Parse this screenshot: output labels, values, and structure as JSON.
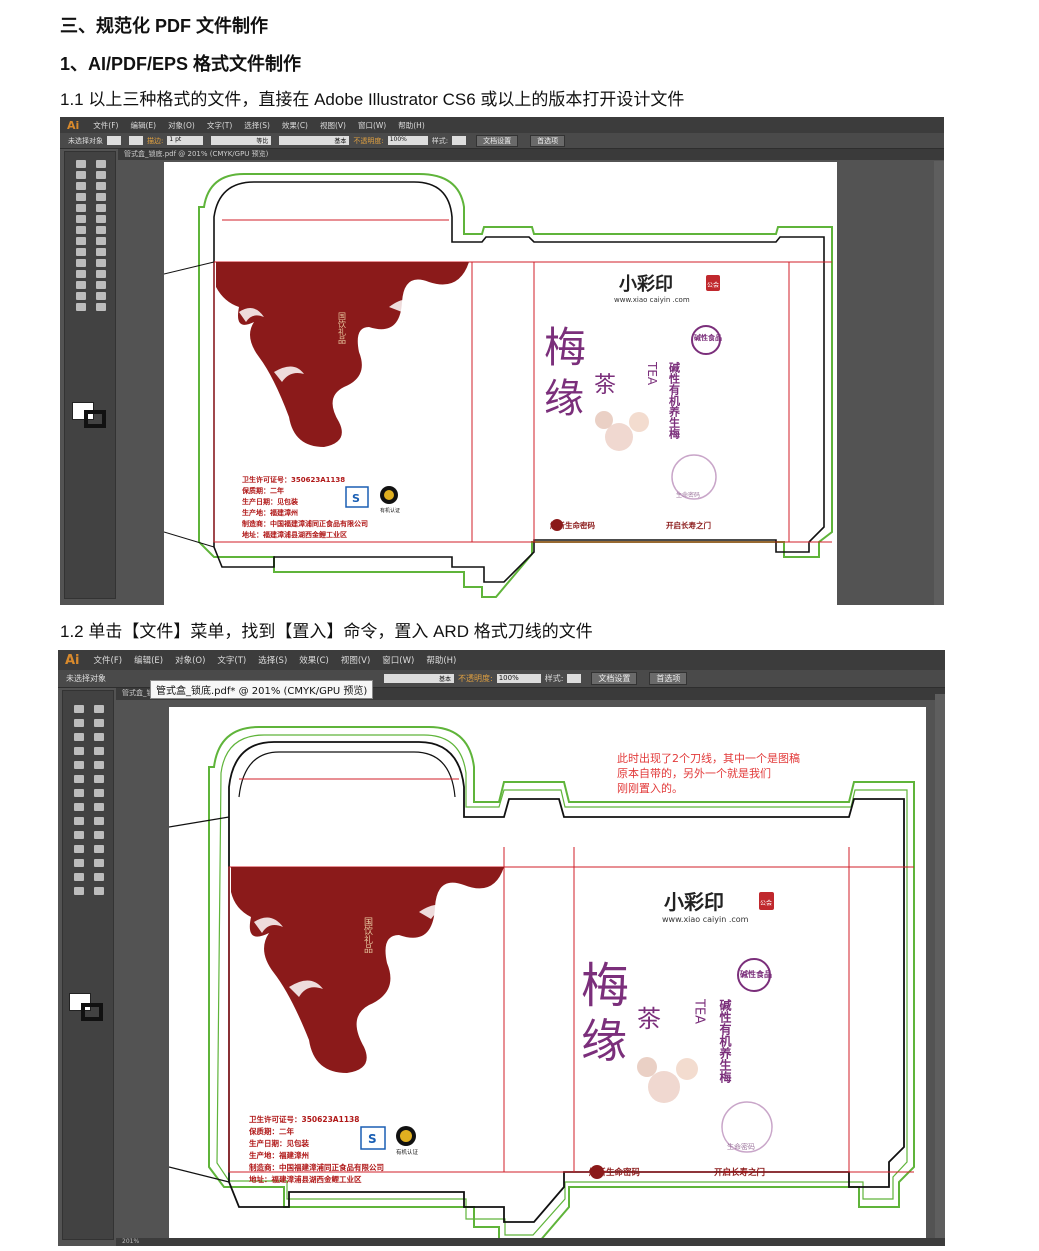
{
  "doc": {
    "heading1": "三、规范化 PDF 文件制作",
    "heading2": "1、AI/PDF/EPS 格式文件制作",
    "para1": "1.1 以上三种格式的文件，直接在 Adobe Illustrator CS6 或以上的版本打开设计文件",
    "para2": "1.2 单击【文件】菜单，找到【置入】命令，置入 ARD 格式刀线的文件"
  },
  "app": {
    "logo": "Ai",
    "menus": [
      "文件(F)",
      "编辑(E)",
      "对象(O)",
      "文字(T)",
      "选择(S)",
      "效果(C)",
      "视图(V)",
      "窗口(W)",
      "帮助(H)"
    ],
    "control": {
      "selection": "未选择对象",
      "stroke_label": "描边:",
      "stroke_value": "1 pt",
      "uniform": "等比",
      "basic": "基本",
      "opacity_label": "不透明度:",
      "opacity_value": "100%",
      "style_label": "样式:",
      "doc_setup": "文档设置",
      "preferences": "首选项"
    },
    "tab_title": "管式盒_锁底.pdf @ 201% (CMYK/GPU 预览)",
    "tooltip": "管式盒_锁底.pdf* @ 201% (CMYK/GPU 预览)",
    "zoom": "201%"
  },
  "package": {
    "brand": "小彩印",
    "seal": "公会",
    "url": "www.xiao caiyin .com",
    "title_main": "梅",
    "title_sub": "缘",
    "title_tea_cn": "茶",
    "tea": "TEA",
    "vertical": "碱性有机养生梅",
    "badge": "碱性食品",
    "stamp": "生命密码",
    "slogan_left": "解析生命密码",
    "slogan_right": "开启长寿之门",
    "info": [
      "卫生许可证号：350623A1138",
      "保质期：二年",
      "生产日期：见包装",
      "生产地：福建漳州",
      "制造商：中国福建漳浦同正食品有限公司",
      "地址：福建漳浦县湖西金鲤工业区"
    ],
    "cert": "有机认证",
    "side_text": "国饮礼品"
  },
  "annotation": "此时出现了2个刀线，其中一个是图稿原本自带的，另外一个就是我们刚刚置入的。",
  "annotation_lines": [
    "此时出现了2个刀线，其中一个是图稿",
    "原本自带的，另外一个就是我们",
    "刚刚置入的。"
  ],
  "colors": {
    "ui_dark": "#535353",
    "burgundy": "#8b1a1a",
    "purple": "#7b2f7b",
    "dieline_green": "#5fb43a",
    "dieline_red": "#d11f2a",
    "annotation_red": "#e23a3a"
  }
}
